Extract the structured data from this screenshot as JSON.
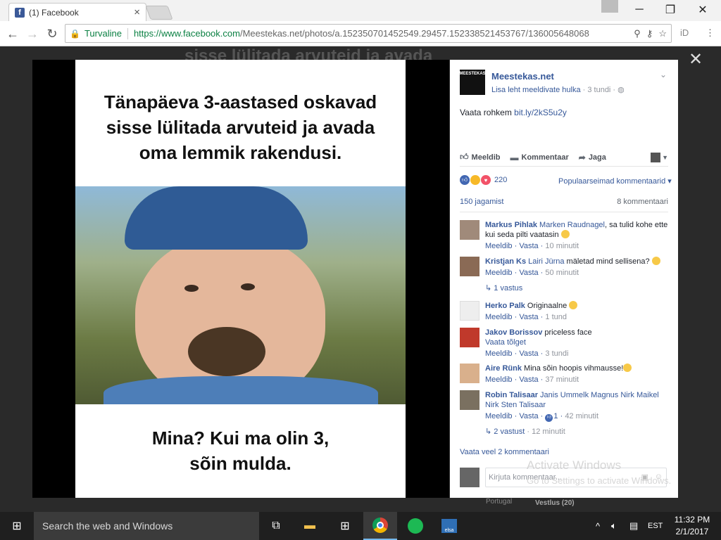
{
  "browser": {
    "tab_title": "(1) Facebook",
    "tab_close": "×",
    "secure_label": "Turvaline",
    "url_host": "https://www.facebook.com",
    "url_path": "/Meestekas.net/photos/a.152350701452549.29457.152338521453767/136005648068",
    "window_minimize": "─",
    "window_maximize": "❐",
    "window_close": "✕"
  },
  "background": {
    "page_text": "sisse lülitada arvuteid ja avada"
  },
  "meme": {
    "top_lines": [
      "Tänapäeva 3-aastased oskavad",
      "sisse lülitada arvuteid ja avada",
      "oma lemmik rakendusi."
    ],
    "bottom_lines": [
      "Mina? Kui ma olin 3,",
      "sõin mulda."
    ]
  },
  "post": {
    "page_name": "Meestekas.net",
    "logo_text": "MEESTEKAS",
    "meta_link": "Lisa leht meeldivate hulka",
    "meta_time": " · 3 tundi · ",
    "text_prefix": "Vaata rohkem ",
    "text_link": "bit.ly/2kS5u2y",
    "actions": {
      "like": "Meeldib",
      "comment": "Kommentaar",
      "share": "Jaga"
    },
    "reaction_count": "220",
    "sort_label": "Populaarseimad kommentaarid ▾",
    "shares": "150 jagamist",
    "comments_count": "8 kommentaari",
    "more_comments": "Vaata veel 2 kommentaari",
    "write_placeholder": "Kirjuta kommentaar..."
  },
  "comments": [
    {
      "author": "Markus Pihlak",
      "tag": "Marken Raudnagel",
      "text": ", sa tulid kohe ette kui seda pilti vaatasin",
      "like": "Meeldib",
      "reply": "Vasta",
      "time": "10 minutit"
    },
    {
      "author": "Kristjan Ks",
      "tag": "Lairi Jürna",
      "text": " mäletad mind sellisena?",
      "like": "Meeldib",
      "reply": "Vasta",
      "time": "50 minutit",
      "replies": "1 vastus"
    },
    {
      "author": "Herko Palk",
      "tag": "",
      "text": " Originaalne",
      "like": "Meeldib",
      "reply": "Vasta",
      "time": "1 tund"
    },
    {
      "author": "Jakov Borissov",
      "tag": "",
      "text": " priceless face",
      "translate": "Vaata tõlget",
      "like": "Meeldib",
      "reply": "Vasta",
      "time": "3 tundi"
    },
    {
      "author": "Aire Rünk",
      "tag": "",
      "text": " Mina sõin hoopis vihmausse!",
      "like": "Meeldib",
      "reply": "Vasta",
      "time": "37 minutit"
    },
    {
      "author": "Robin Talisaar",
      "tag": "Janis Ummelk Magnus Nirk Maikel Nirk Sten Talisaar",
      "text": "",
      "like": "Meeldib",
      "reply": "Vasta",
      "like_count": "1",
      "time": "42 minutit",
      "replies": "2 vastust",
      "replies_time": " · 12 minutit"
    }
  ],
  "windows": {
    "activate_title": "Activate Windows",
    "activate_sub": "Go to Settings to activate Windows.",
    "bg_chat_left": "Portugal",
    "bg_chat_right": "Vestlus (20)"
  },
  "taskbar": {
    "search": "Search the web and Windows",
    "lang": "EST",
    "time": "11:32 PM",
    "date": "2/1/2017",
    "elsa_label": "elsa"
  },
  "colors": {
    "fb_blue": "#365899",
    "secure_green": "#0b8043",
    "taskbar": "#1f1f1f"
  }
}
